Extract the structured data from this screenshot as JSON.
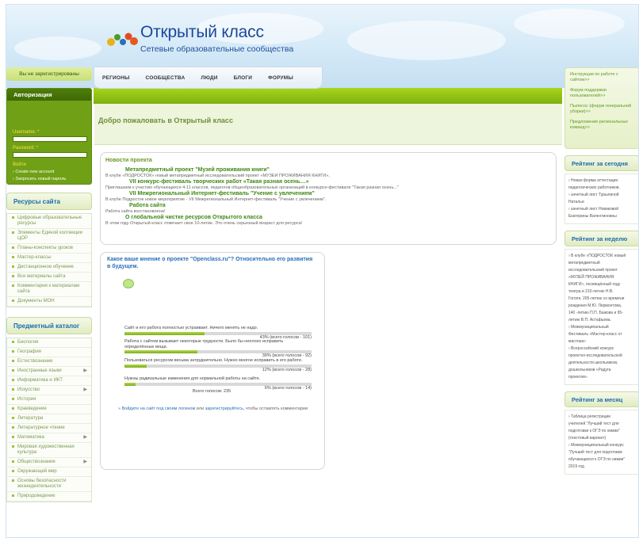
{
  "logo": {
    "title": "Открытый класс",
    "subtitle": "Сетевые образовательные сообщества"
  },
  "nav": [
    "РЕГИОНЫ",
    "СООБЩЕСТВА",
    "ЛЮДИ",
    "БЛОГИ",
    "ФОРУМЫ"
  ],
  "left": {
    "status": "Вы не зарегистрированы",
    "auth": {
      "title": "Авторизация",
      "username_label": "Username: *",
      "password_label": "Password: *",
      "login_button": "Войти",
      "create_account": "Create new account",
      "request_password": "Запросить новый пароль"
    },
    "resources": {
      "title": "Ресурсы сайта",
      "items": [
        "Цифровые образовательные ресурсы",
        "Элементы Единой коллекции ЦОР",
        "Планы-конспекты уроков",
        "Мастер-классы",
        "Дистанционное обучение",
        "Все материалы сайта",
        "Комментарии к материалам сайта",
        "Документы МОН"
      ]
    },
    "catalog": {
      "title": "Предметный каталог",
      "items": [
        "Биология",
        "География",
        "Естествознание",
        "Иностранные языки",
        "Информатика и ИКТ",
        "Искусство",
        "История",
        "Краеведение",
        "Литература",
        "Литературное чтение",
        "Математика",
        "Мировая художественная культура",
        "Обществознание",
        "Окружающий мир",
        "Основы безопасности жизнедеятельности",
        "Природоведение"
      ]
    }
  },
  "welcome": "Добро пожаловать в Открытый класс",
  "news": {
    "heading": "Новости проекта",
    "items": [
      {
        "title": "Метапредметный проект \"Музей проживания книги\"",
        "body": "В клубе «ПОДРОСТОК» новый метапредметный исследовательский проект «МУЗЕЙ ПРОЖИВАНИЯ КНИГИ»,"
      },
      {
        "title": "VII конкурс-фестиваль творческих работ «Такая разная осень…»",
        "body": "Приглашаем к участию обучающихся 4-11 классов, педагогов общеобразовательных организаций в конкурсе-фестивале \"Такая разная осень...\""
      },
      {
        "title": "VII Межрегиональный Интернет-фестиваль \"Учение с увлечением\"",
        "body": "В клубе Подросток новое мероприятие - VII Межрегиональный Интернет-фестиваль \"Учение с увлечением\"."
      },
      {
        "title": "Работа сайта",
        "body": "Работа сайта восстановлена!"
      },
      {
        "title": "О глобальной чистке ресурсов Открытого класса",
        "body": "В этом году Открытый класс отмечает свое 10-летие. Это очень серьезный возраст для ресурса!"
      }
    ]
  },
  "poll": {
    "question": "Какое ваше мнение о проекте \"Openclass.ru\"? Относительно его развития в будущем.",
    "options": [
      {
        "text": "Сайт и его работа полностью устраивает. Ничего менять не надо.",
        "count": "43% (всего голосов - 101)",
        "percent": 43
      },
      {
        "text": "Работа с сайтом вызывает некоторые трудности. Было бы неплохо исправить определённые вещи.",
        "count": "39% (всего голосов - 92)",
        "percent": 39
      },
      {
        "text": "Пользоваться ресурсом весьма затруднительно. Нужно многое исправить в его работе.",
        "count": "12% (всего голосов - 28)",
        "percent": 12
      },
      {
        "text": "Нужны радикальные изменения для нормальной работы на сайте.",
        "count": "6% (всего голосов - 14)",
        "percent": 6
      }
    ],
    "total": "Всего голосов: 235",
    "footer_pre": "» ",
    "login_link": "Войдите на сайт под своим логином",
    "footer_or": " или ",
    "register_link": "зарегистрируйтесь",
    "footer_post": ", чтобы оставлять комментарии"
  },
  "right": {
    "links": [
      "Инструкции по работе с сайтом>>",
      "Форум поддержки пользователей>>",
      "Пылесос (форум генеральной уборки)>>",
      "Предложение региональных команд>>"
    ],
    "today": {
      "title": "Рейтинг за сегодня",
      "lines": [
        "› Новая форма аттестации",
        "педагогических работников.",
        "› зачетный лист Турылиной",
        "Натальи",
        "› зачетный лист Новиковой",
        "Екатерины Валентиновны"
      ]
    },
    "week": {
      "title": "Рейтинг за неделю",
      "lines": [
        "› В клубе «ПОДРОСТОК новый",
        "метапредметный",
        "исследовательский проект",
        "«МУЗЕЙ ПРОЖИВАНИЯ",
        "КНИГИ», посвящённый году",
        "театра и 210-летию Н.В.",
        "Гоголя, 205-летию со времени",
        "рождения М.Ю. Лермонтова,",
        "140 -летию П.П. Бажова и 95-",
        "летию В.П. Астафьева.",
        "› Межмуниципальный",
        "Фестиваль «Мастер-класс от",
        "мастера»",
        "› Всероссийский конкурс",
        "проектно-исследовательской",
        "деятельности школьников,",
        "дошкольников «Радуга",
        "проектов»"
      ]
    },
    "month": {
      "title": "Рейтинг за месяц",
      "lines": [
        "› Таблица регистрации",
        "учителей \"Лучший тест для",
        "подготовки к ОГЭ по химии\"",
        "(текстовый вариант)",
        "› Межмуниципальный конкурс",
        "\"Лучший тест для подготовки",
        "обучающихся к ОГЭ по химии\"",
        "2019 год"
      ]
    }
  }
}
